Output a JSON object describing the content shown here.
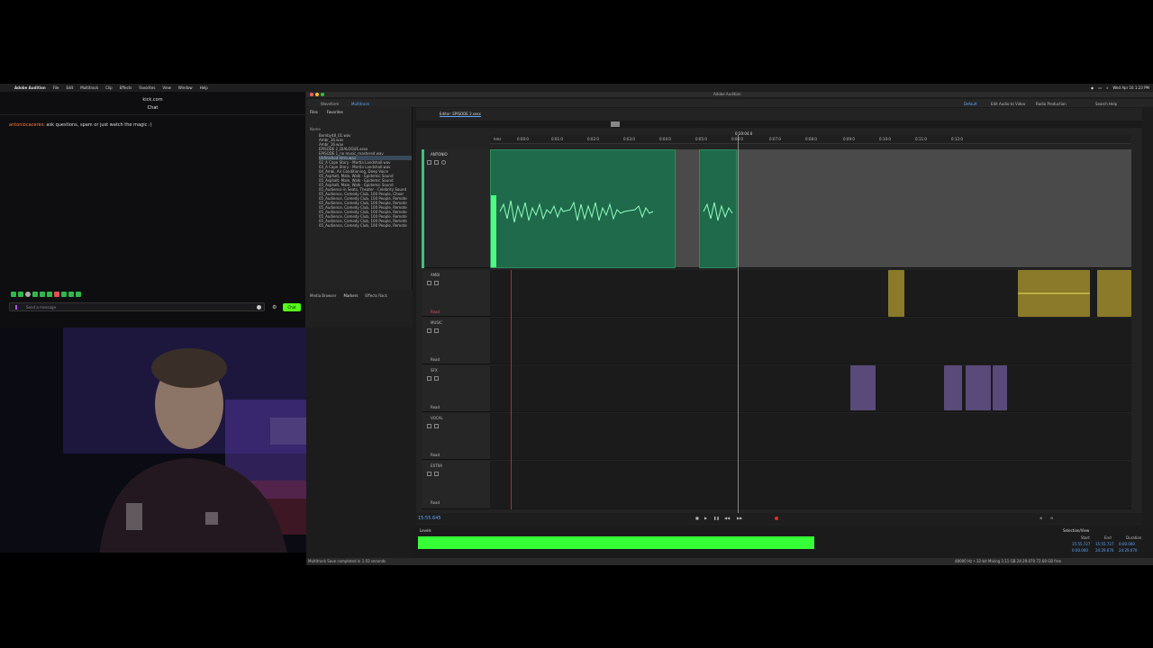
{
  "menubar": {
    "app": "Adobe Audition",
    "items": [
      "File",
      "Edit",
      "Multitrack",
      "Clip",
      "Effects",
      "Favorites",
      "View",
      "Window",
      "Help"
    ],
    "window_title": "Adobe Audition",
    "clock": "Wed Apr 16 1:23 PM"
  },
  "chat": {
    "site": "kick.com",
    "title": "Chat",
    "message_user": "antoniocaceres",
    "message_text": "ask questions, spam or just watch the magic :)",
    "input_placeholder": "Send a message",
    "send_label": "Chat"
  },
  "files": {
    "tabs": [
      "Files",
      "Favorites"
    ],
    "column": "Name",
    "items": [
      "Bomby48_01.wav",
      "Ambr_16.wav",
      "Ambr_16.wav",
      "EPISODE 2_DIALOGUE.sesx",
      "EPISODE 1_no music_mastered.wav",
      "Unfinished Intro.wav",
      "02_A Cape Story - Mortia Landshall.wav",
      "03_A Cape Story - Mortia Landshall.wav",
      "04_Ambi, Air Conditioning, Deep Voice",
      "05_Asphalt, Male, Walk - Epidemic Sound",
      "05_Asphalt, Male, Walk - Epidemic Sound",
      "05_Asphalt, Male, Walk - Epidemic Sound",
      "05_Audience in Seats, Theater - Celebrity Sound",
      "05_Audience, Comedy Club, 100 People, Cheer",
      "05_Audience, Comedy Club, 100 People, Remote",
      "05_Audience, Comedy Club, 100 People, Remote",
      "05_Audience, Comedy Club, 100 People, Remote",
      "05_Audience, Comedy Club, 100 People, Remote",
      "05_Audience, Comedy Club, 100 People, Remote",
      "05_Audience, Comedy Club, 100 People, Remote",
      "05_Audience, Comedy Club, 100 People, Remote"
    ],
    "lower_tabs": [
      "Media Browser",
      "Markers",
      "Effects Rack"
    ]
  },
  "workspace": {
    "tabs": [
      "Waveform",
      "Multitrack"
    ],
    "editor_tab": "Editor: EPISODE 2.sesx",
    "right_items": [
      "Default",
      "Edit Audio to Video",
      "Radio Production",
      "Search Help"
    ]
  },
  "timeline": {
    "playhead_time": "0:20:04.0",
    "ruler": [
      "hms",
      "0:00:0",
      "0:01:0",
      "0:02:0",
      "0:03:0",
      "0:04:0",
      "0:05:0",
      "0:06:0",
      "0:07:0",
      "0:08:0",
      "0:09:0",
      "0:10:0",
      "0:11:0",
      "0:12:0"
    ],
    "current_time": "15:55.645"
  },
  "tracks": [
    {
      "name": "ANTONIO",
      "read": "Read",
      "color": "#3fbf7f"
    },
    {
      "name": "AMBI",
      "read": "Read",
      "color": "#c8b84a"
    },
    {
      "name": "MUSIC",
      "read": "Read",
      "color": "#cccccc"
    },
    {
      "name": "SFX",
      "read": "Read",
      "color": "#b07fd8"
    },
    {
      "name": "VOCAL",
      "read": "Read",
      "color": "#cccccc"
    },
    {
      "name": "EXTRA",
      "read": "Read",
      "color": "#cccccc"
    }
  ],
  "levels": {
    "title": "Levels",
    "selection_title": "Selection/View",
    "headers": [
      "Start",
      "End",
      "Duration"
    ],
    "selection": [
      "15:55.727",
      "15:55.727",
      "0:00.000"
    ],
    "view": [
      "0:00.000",
      "24:29.070",
      "24:29.070"
    ]
  },
  "status": {
    "left": "Multitrack Save completed in 1.03 seconds",
    "right": "48000 Hz • 32-bit Mixing   3.11 GB   24:29.070   72.68 GB free"
  }
}
